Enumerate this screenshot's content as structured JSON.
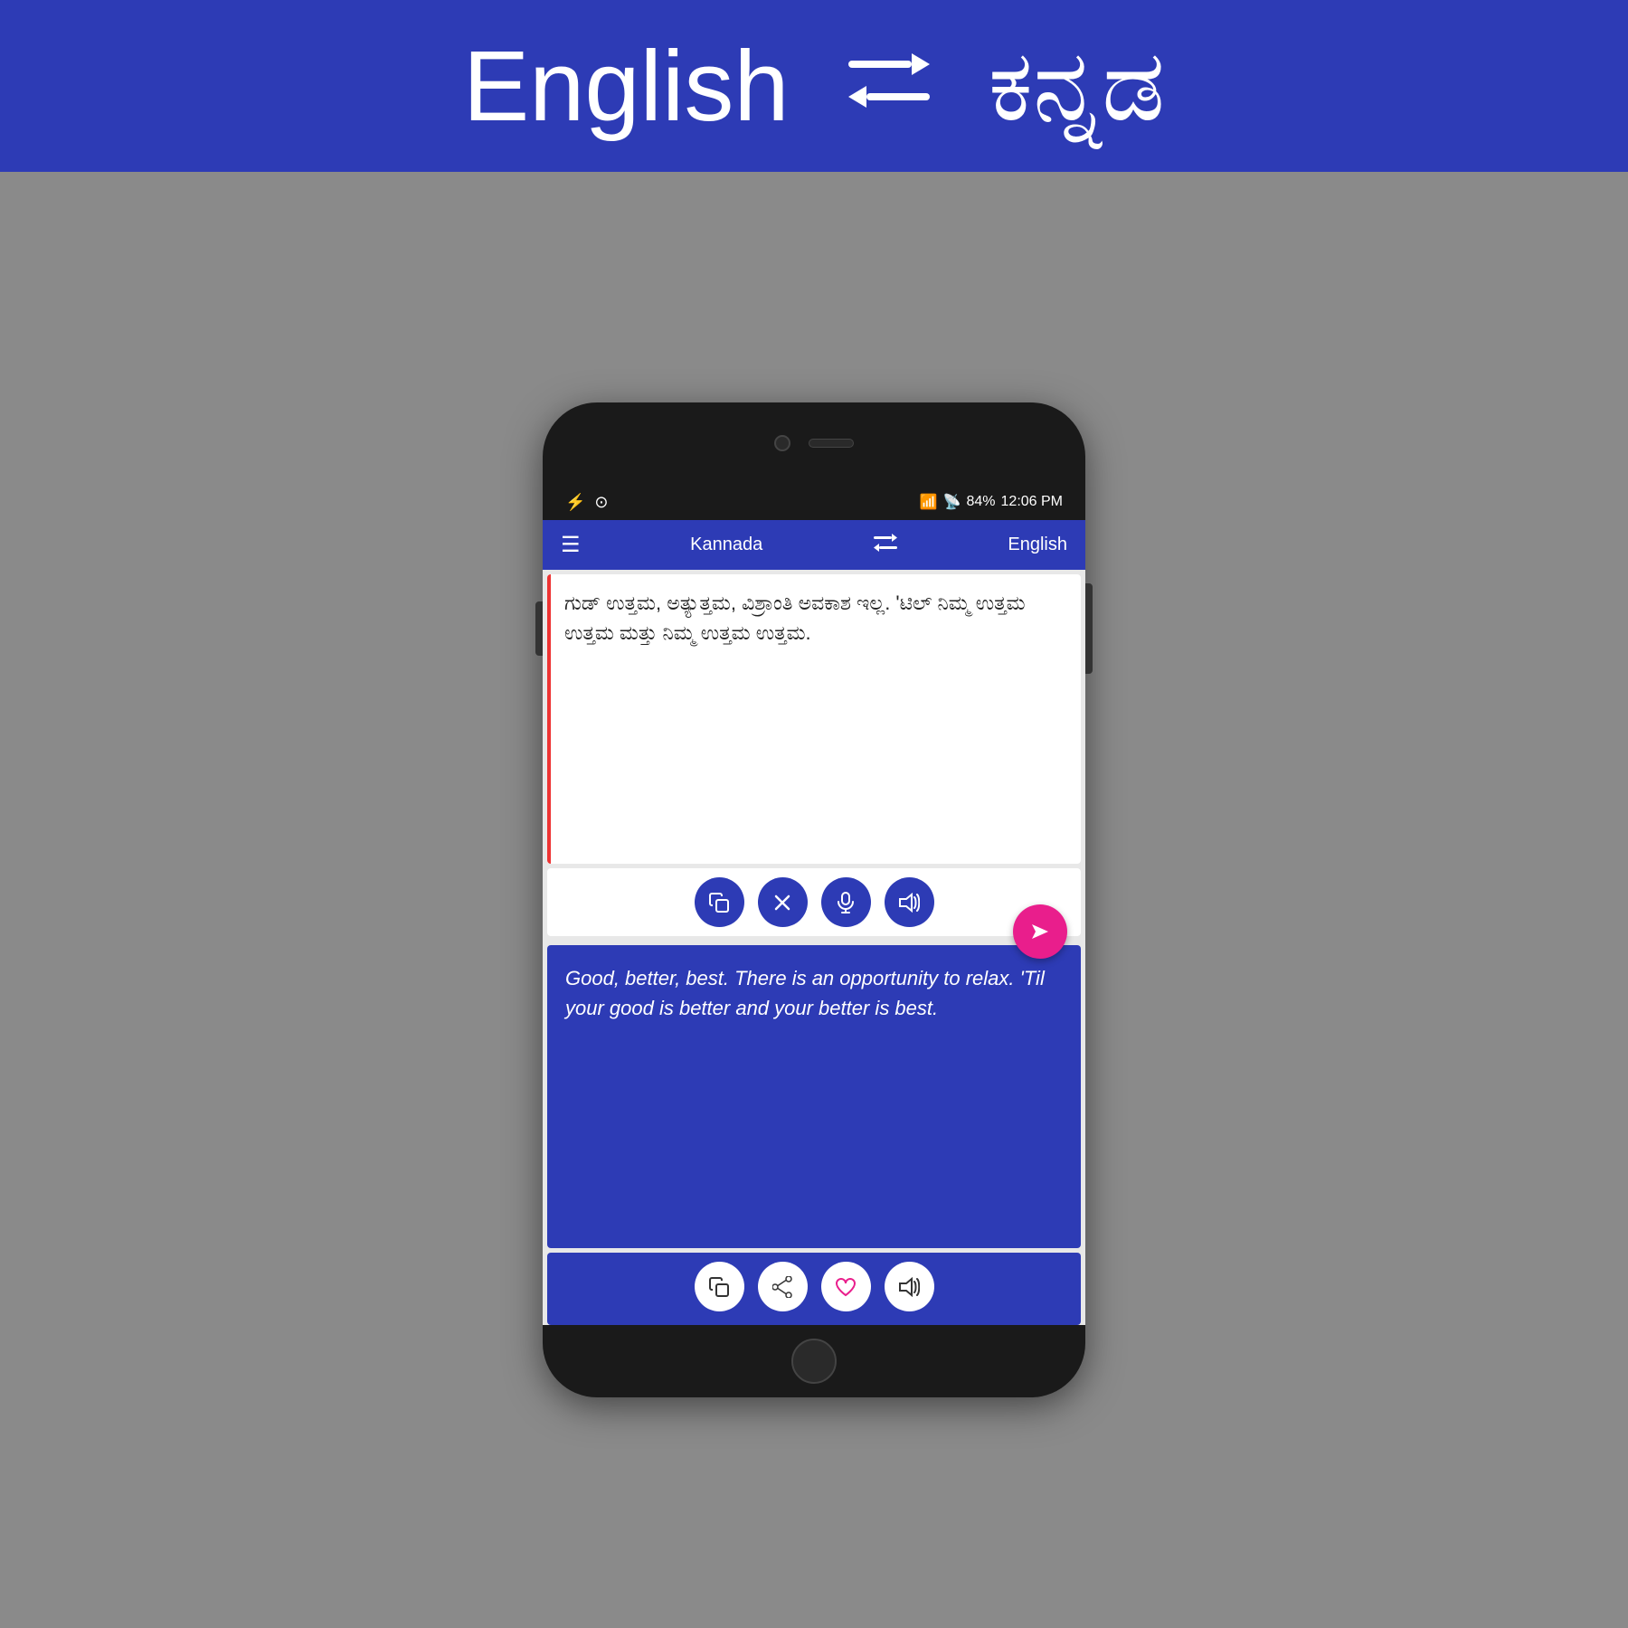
{
  "banner": {
    "lang_left": "English",
    "lang_right": "ಕನ್ನಡ",
    "swap_icon": "⇄"
  },
  "status_bar": {
    "battery": "84%",
    "time": "12:06 PM",
    "icons_left": [
      "⚡",
      "⊙"
    ]
  },
  "app_bar": {
    "lang_left": "Kannada",
    "lang_right": "English",
    "hamburger": "☰",
    "swap": "⇄"
  },
  "input": {
    "text": "ಗುಡ್ ಉತ್ತಮ, ಅತ್ಯುತ್ತಮ, ವಿಶ್ರಾಂತಿ ಅವಕಾಶ ಇಲ್ಲ. 'ಟಿಲ್ ನಿಮ್ಮ ಉತ್ತಮ ಉತ್ತಮ ಮತ್ತು ನಿಮ್ಮ ಉತ್ತಮ ಉತ್ತಮ."
  },
  "input_buttons": {
    "copy": "📋",
    "clear": "✕",
    "mic": "🎤",
    "speaker": "🔊",
    "send": "▶"
  },
  "output": {
    "text": "Good, better, best. There is an opportunity to relax. 'Til your good is better and your better is best."
  },
  "output_buttons": {
    "copy": "📋",
    "share": "⎙",
    "favorite": "♥",
    "speaker": "🔊"
  }
}
